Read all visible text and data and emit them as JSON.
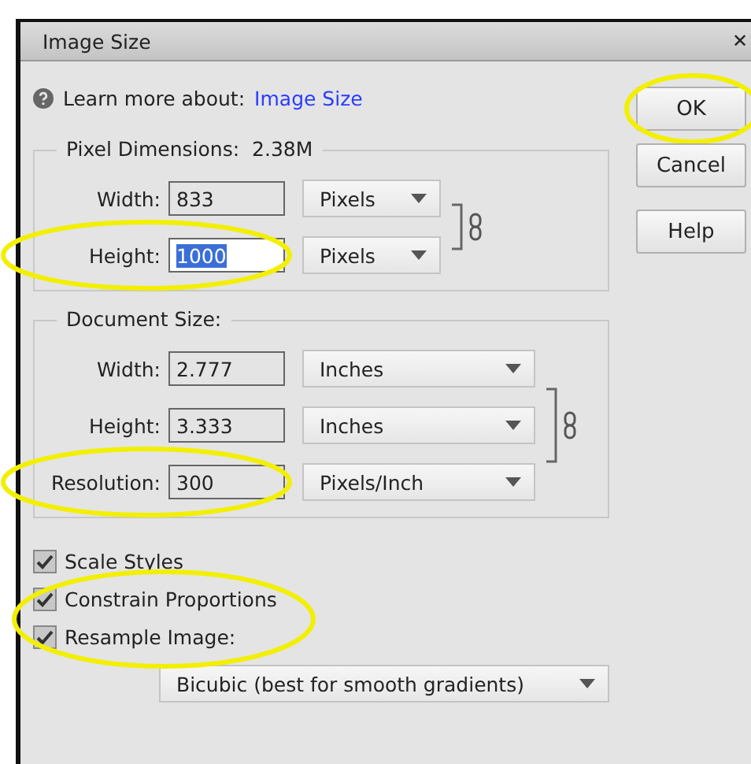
{
  "window": {
    "title": "Image Size",
    "close": "✕"
  },
  "help": {
    "text": "Learn more about:",
    "link": "Image Size"
  },
  "buttons": [
    {
      "label": "OK",
      "highlighted": true
    },
    {
      "label": "Cancel",
      "highlighted": false
    },
    {
      "label": "Help",
      "highlighted": false
    }
  ],
  "pixel_dimensions": {
    "title": "Pixel Dimensions:",
    "value": "2.38M",
    "linked": true,
    "rows": [
      {
        "label": "Width:",
        "value": "833",
        "unit": "Pixels",
        "highlighted": false,
        "text_selected": false
      },
      {
        "label": "Height:",
        "value": "1000",
        "unit": "Pixels",
        "highlighted": true,
        "text_selected": true
      }
    ]
  },
  "document_size": {
    "title": "Document Size:",
    "linked": true,
    "rows": [
      {
        "label": "Width:",
        "value": "2.777",
        "unit": "Inches",
        "highlighted": false,
        "text_selected": false
      },
      {
        "label": "Height:",
        "value": "3.333",
        "unit": "Inches",
        "highlighted": false,
        "text_selected": false
      },
      {
        "label": "Resolution:",
        "value": "300",
        "unit": "Pixels/Inch",
        "highlighted": true,
        "text_selected": false
      }
    ]
  },
  "options": {
    "highlighted": true,
    "checkboxes": [
      {
        "label": "Scale Styles",
        "checked": true
      },
      {
        "label": "Constrain Proportions",
        "checked": true
      },
      {
        "label": "Resample Image:",
        "checked": true
      }
    ]
  },
  "resample_method": "Bicubic (best for smooth gradients)"
}
